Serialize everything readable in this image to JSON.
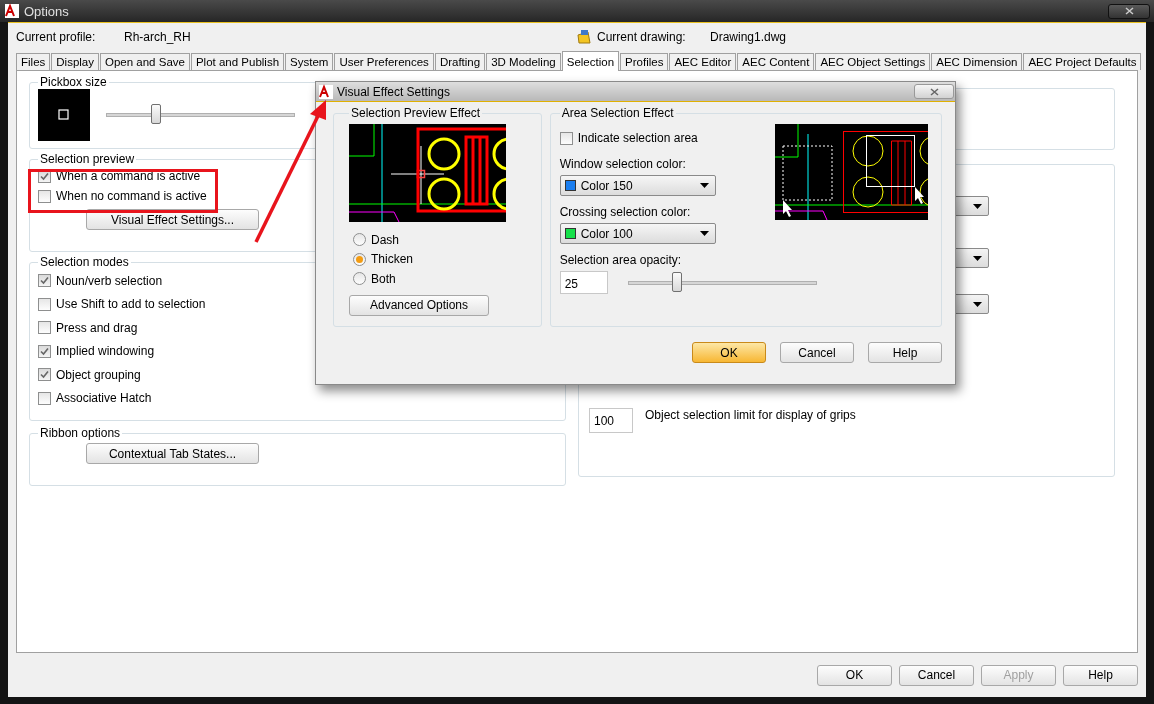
{
  "window": {
    "title": "Options"
  },
  "profile": {
    "label": "Current profile:",
    "value": "Rh-arch_RH"
  },
  "drawing": {
    "label": "Current drawing:",
    "value": "Drawing1.dwg"
  },
  "tabs": [
    {
      "label": "Files",
      "selected": false
    },
    {
      "label": "Display",
      "selected": false
    },
    {
      "label": "Open and Save",
      "selected": false
    },
    {
      "label": "Plot and Publish",
      "selected": false
    },
    {
      "label": "System",
      "selected": false
    },
    {
      "label": "User Preferences",
      "selected": false
    },
    {
      "label": "Drafting",
      "selected": false
    },
    {
      "label": "3D Modeling",
      "selected": false
    },
    {
      "label": "Selection",
      "selected": true
    },
    {
      "label": "Profiles",
      "selected": false
    },
    {
      "label": "AEC Editor",
      "selected": false
    },
    {
      "label": "AEC Content",
      "selected": false
    },
    {
      "label": "AEC Object Settings",
      "selected": false
    },
    {
      "label": "AEC Dimension",
      "selected": false
    },
    {
      "label": "AEC Project Defaults",
      "selected": false
    }
  ],
  "pickbox": {
    "title": "Pickbox size",
    "level": 0.26
  },
  "selection_preview": {
    "title": "Selection preview",
    "options": [
      {
        "label": "When a command is active",
        "checked": true
      },
      {
        "label": "When no command is active",
        "checked": false
      }
    ],
    "button": "Visual Effect Settings..."
  },
  "selection_modes": {
    "title": "Selection modes",
    "options": [
      {
        "label": "Noun/verb selection",
        "checked": true
      },
      {
        "label": "Use Shift to add to selection",
        "checked": false
      },
      {
        "label": "Press and drag",
        "checked": false
      },
      {
        "label": "Implied windowing",
        "checked": true
      },
      {
        "label": "Object grouping",
        "checked": true
      },
      {
        "label": "Associative Hatch",
        "checked": false
      }
    ]
  },
  "ribbon_options": {
    "title": "Ribbon options",
    "button": "Contextual Tab States..."
  },
  "grips": {
    "limit_value": "100",
    "limit_label": "Object selection limit for display of grips"
  },
  "buttons": [
    {
      "label": "OK",
      "disabled": false
    },
    {
      "label": "Cancel",
      "disabled": false
    },
    {
      "label": "Apply",
      "disabled": true
    },
    {
      "label": "Help",
      "disabled": false
    }
  ],
  "dialog": {
    "title": "Visual Effect Settings",
    "preview_group": {
      "title": "Selection Preview Effect",
      "options": [
        {
          "label": "Dash",
          "selected": false
        },
        {
          "label": "Thicken",
          "selected": true
        },
        {
          "label": "Both",
          "selected": false
        }
      ],
      "button": "Advanced Options"
    },
    "area_group": {
      "title": "Area Selection Effect",
      "indicate": {
        "label": "Indicate selection area",
        "checked": false
      },
      "colors": [
        {
          "label": "Window selection color:",
          "value": "Color 150",
          "color": "#1a7ef0"
        },
        {
          "label": "Crossing selection color:",
          "value": "Color 100",
          "color": "#16e04a"
        }
      ],
      "opacity": {
        "label": "Selection area opacity:",
        "value": "25",
        "level": 0.26
      }
    },
    "buttons": [
      {
        "label": "OK",
        "default": true
      },
      {
        "label": "Cancel",
        "default": false
      },
      {
        "label": "Help",
        "default": false
      }
    ]
  }
}
